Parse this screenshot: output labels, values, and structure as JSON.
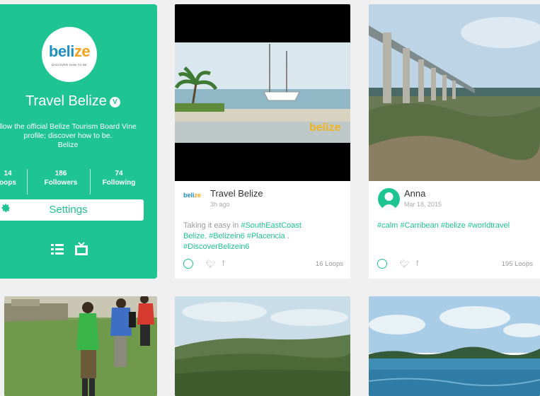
{
  "profile": {
    "logo_text_a": "beli",
    "logo_text_b": "ze",
    "logo_tagline": "DISCOVER HOW TO BE",
    "name": "Travel Belize",
    "bio_line1": "llow the official Belize Tourism Board Vine",
    "bio_line2": "profile; discover how to be.",
    "bio_line3": "Belize",
    "stats": [
      {
        "value": "14",
        "label": "oops"
      },
      {
        "value": "186",
        "label": "Followers"
      },
      {
        "value": "74",
        "label": "Following"
      }
    ],
    "settings_label": "Settings",
    "icons": [
      "list-view-icon",
      "tv-view-icon",
      "gear-icon",
      "verified-badge-icon"
    ]
  },
  "posts": [
    {
      "author": "Travel Belize",
      "time": "3h ago",
      "caption_text": "Taking it easy in ",
      "caption_tags": [
        "#SouthEastCoast",
        "Belize.",
        "#Belizein6",
        "#Placencia",
        ".",
        "#DiscoverBelizein6"
      ],
      "loops": "16 Loops",
      "watermark": "belize"
    },
    {
      "author": "Anna",
      "time": "Mar 18, 2015",
      "caption_tags": [
        "#calm",
        "#Carribean",
        "#belize",
        "#worldtravel"
      ],
      "loops": "195 Loops"
    }
  ],
  "colors": {
    "brand_green": "#1fc493",
    "logo_blue": "#1f8fc0",
    "logo_orange": "#f2a21b",
    "background": "#f0f0f0"
  }
}
